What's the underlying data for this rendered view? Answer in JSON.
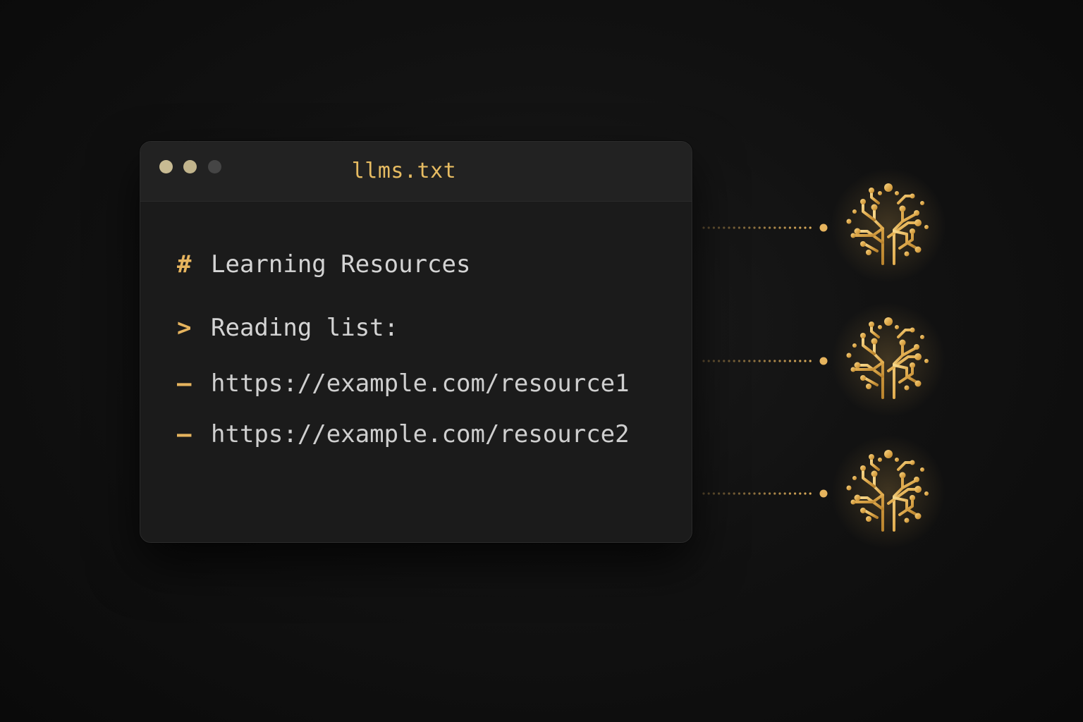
{
  "window": {
    "title": "llms.txt",
    "controls": [
      "window-dot",
      "window-dot",
      "window-dot"
    ]
  },
  "document": {
    "heading": {
      "marker": "#",
      "text": "Learning Resources"
    },
    "quote": {
      "marker": ">",
      "text": "Reading list:"
    },
    "items": [
      {
        "marker": "–",
        "text": "https://example.com/resource1"
      },
      {
        "marker": "–",
        "text": "https://example.com/resource2"
      }
    ]
  },
  "nodes": [
    {
      "icon": "circuit-brain-icon"
    },
    {
      "icon": "circuit-brain-icon"
    },
    {
      "icon": "circuit-brain-icon"
    }
  ],
  "colors": {
    "accent": "#e6b45e",
    "background": "#121212",
    "window": "#1b1b1b",
    "titlebar": "#222222",
    "text": "#d4d4d4"
  }
}
